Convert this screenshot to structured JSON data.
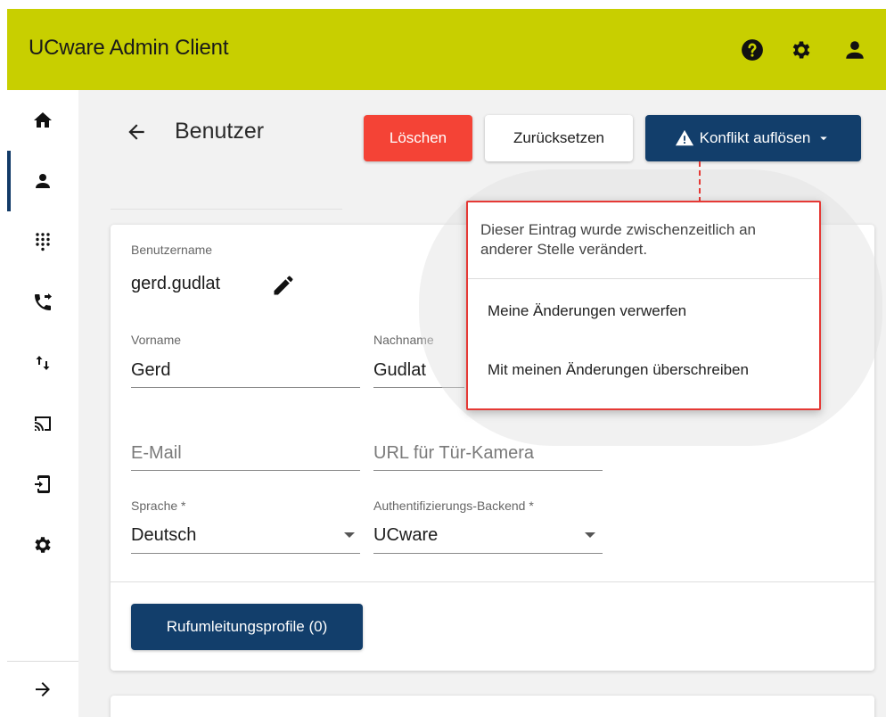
{
  "app": {
    "title": "UCware Admin Client"
  },
  "topbar": {
    "icons": [
      "help-icon",
      "gear-icon",
      "account-icon"
    ]
  },
  "sidebar": {
    "items": [
      {
        "icon": "home-icon"
      },
      {
        "icon": "user-icon",
        "active": true
      },
      {
        "icon": "dialpad-icon"
      },
      {
        "icon": "call-forward-icon"
      },
      {
        "icon": "swap-vertical-icon"
      },
      {
        "icon": "cast-icon"
      },
      {
        "icon": "phone-settings-icon"
      },
      {
        "icon": "gear-icon"
      }
    ],
    "collapse_icon": "arrow-right-icon"
  },
  "header": {
    "title": "Benutzer",
    "delete_label": "Löschen",
    "reset_label": "Zurücksetzen",
    "conflict_label": "Konflikt auflösen"
  },
  "form": {
    "username_label": "Benutzername",
    "username_value": "gerd.gudlat",
    "firstname_label": "Vorname",
    "firstname_value": "Gerd",
    "lastname_label": "Nachname",
    "lastname_value": "Gudlat",
    "email_placeholder": "E-Mail",
    "doorcam_placeholder": "URL für Tür-Kamera",
    "language_label": "Sprache *",
    "language_value": "Deutsch",
    "auth_label": "Authentifizierungs-Backend *",
    "auth_value": "UCware",
    "profiles_button": "Rufumleitungsprofile (0)"
  },
  "conflict_menu": {
    "message": "Dieser Eintrag wurde zwischenzeitlich an anderer Stelle verändert.",
    "options": [
      "Meine Änderungen verwerfen",
      "Mit meinen Änderungen überschreiben"
    ]
  },
  "colors": {
    "topbar": "#c8cf00",
    "primary": "#123e6b",
    "danger": "#f44336",
    "highlight_border": "#e53935"
  }
}
